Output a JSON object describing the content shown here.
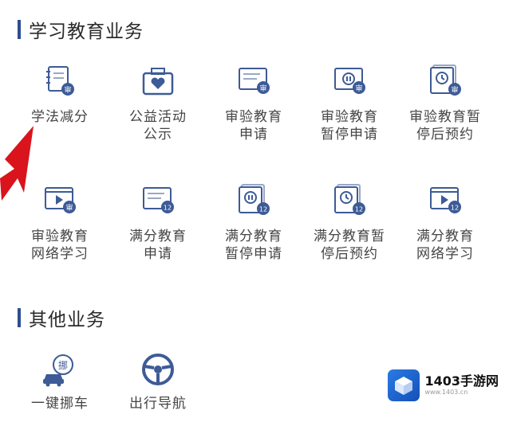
{
  "sections": [
    {
      "title": "学习教育业务",
      "items": [
        {
          "label": "学法减分",
          "icon": "notebook-icon"
        },
        {
          "label": "公益活动\n公示",
          "icon": "briefcase-heart-icon"
        },
        {
          "label": "审验教育\n申请",
          "icon": "document-badge-icon"
        },
        {
          "label": "审验教育\n暂停申请",
          "icon": "pause-document-icon"
        },
        {
          "label": "审验教育暂\n停后预约",
          "icon": "clock-document-icon"
        },
        {
          "label": "审验教育\n网络学习",
          "icon": "video-document-icon"
        },
        {
          "label": "满分教育\n申请",
          "icon": "document-12-icon"
        },
        {
          "label": "满分教育\n暂停申请",
          "icon": "pause-document-12-icon"
        },
        {
          "label": "满分教育暂\n停后预约",
          "icon": "clock-document-12-icon"
        },
        {
          "label": "满分教育\n网络学习",
          "icon": "video-document-12-icon"
        }
      ]
    },
    {
      "title": "其他业务",
      "items": [
        {
          "label": "一键挪车",
          "icon": "move-car-icon"
        },
        {
          "label": "出行导航",
          "icon": "steering-wheel-icon"
        }
      ]
    }
  ],
  "badges": {
    "study": "审",
    "twelve": "12",
    "move": "挪"
  },
  "watermark": {
    "name": "1403手游网",
    "url": "www.1403.cn"
  },
  "colors": {
    "icon_blue": "#3d5b96",
    "title_bar": "#2f4d8f",
    "arrow": "#d9141c"
  }
}
